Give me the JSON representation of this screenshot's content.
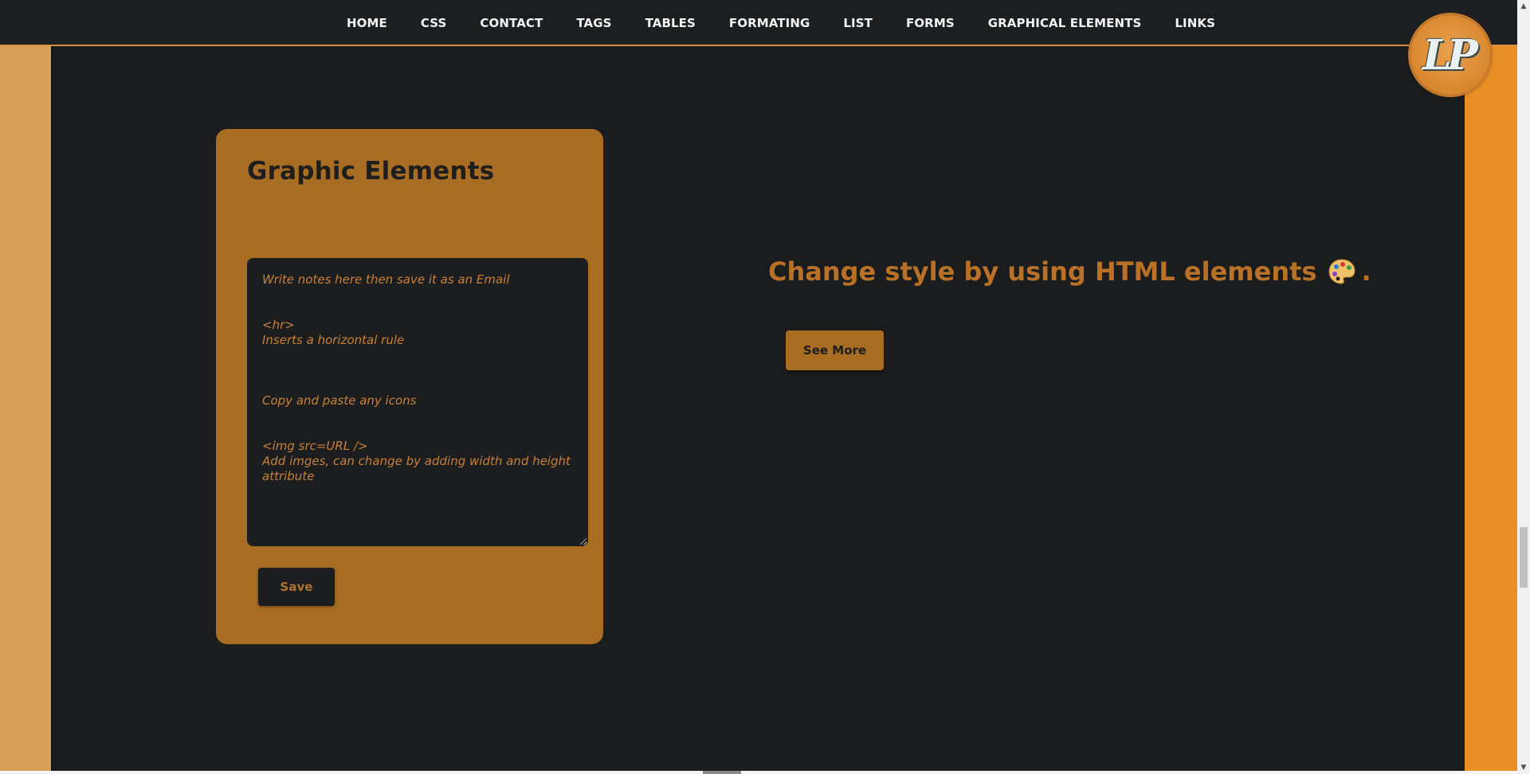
{
  "nav": {
    "items": [
      {
        "label": "HOME"
      },
      {
        "label": "CSS"
      },
      {
        "label": "CONTACT"
      },
      {
        "label": "TAGS"
      },
      {
        "label": "TABLES"
      },
      {
        "label": "FORMATING"
      },
      {
        "label": "LIST"
      },
      {
        "label": "FORMS"
      },
      {
        "label": "GRAPHICAL ELEMENTS"
      },
      {
        "label": "LINKS"
      }
    ]
  },
  "logo": {
    "text": "LP"
  },
  "card": {
    "title": "Graphic Elements",
    "notes": {
      "intro": "Write notes here then save it as an Email",
      "hr_tag": "<hr>",
      "hr_desc": "Inserts a horizontal rule",
      "icons_line": "Copy and paste any icons",
      "img_tag": "<img src=URL />",
      "img_desc": "Add imges, can change by adding width and height attribute"
    },
    "save_label": "Save"
  },
  "main": {
    "headline": "Change style by using HTML elements",
    "headline_icon": "palette-icon",
    "headline_suffix": ".",
    "see_more_label": "See More"
  },
  "colors": {
    "background": "#1b1c1e",
    "accent": "#a86c23",
    "left_strip": "#d9a05a",
    "right_strip": "#e98f27",
    "headline": "#b87127"
  }
}
